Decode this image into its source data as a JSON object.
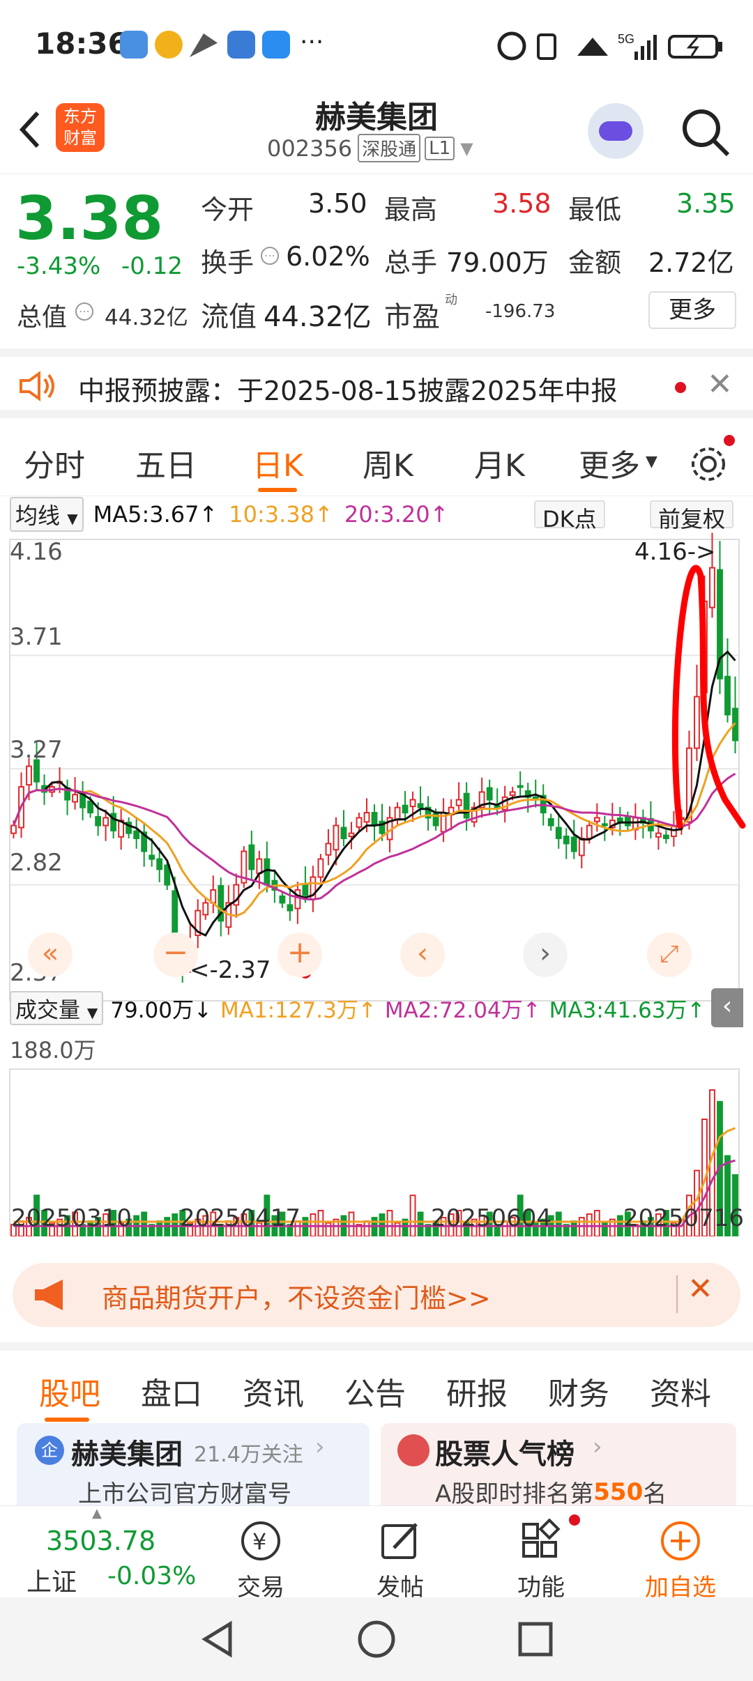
{
  "status_bar": {
    "time": "18:36",
    "dots": "···"
  },
  "header": {
    "logo_line1": "东方",
    "logo_line2": "财富",
    "stock_name": "赫美集团",
    "stock_code": "002356",
    "market_tag": "深股通",
    "level_tag": "L1"
  },
  "quote": {
    "price": "3.38",
    "change_pct": "-3.43%",
    "change": "-0.12",
    "open_label": "今开",
    "open": "3.50",
    "high_label": "最高",
    "high": "3.58",
    "low_label": "最低",
    "low": "3.35",
    "turnover_label": "换手",
    "turnover": "6.02%",
    "volume_label": "总手",
    "volume": "79.00万",
    "amount_label": "金额",
    "amount": "2.72亿",
    "mktcap_label": "总值",
    "mktcap": "44.32亿",
    "float_label": "流值",
    "float_cap": "44.32亿",
    "pe_label": "市盈",
    "pe_sup": "动",
    "pe": "-196.73",
    "more_label": "更多"
  },
  "notice": {
    "text": "中报预披露：于2025-08-15披露2025年中报"
  },
  "period_tabs": [
    "分时",
    "五日",
    "日K",
    "周K",
    "月K",
    "更多"
  ],
  "active_tab": "日K",
  "chart_header": {
    "indicator": "均线",
    "ma5": "MA5:3.67↑",
    "ma10": "10:3.38↑",
    "ma20": "20:3.20↑",
    "dk": "DK点",
    "fq": "前复权"
  },
  "volume_header": {
    "label": "成交量",
    "vol": "79.00万↓",
    "ma1": "MA1:127.3万↑",
    "ma2": "MA2:72.04万↑",
    "ma3": "MA3:41.63万↑",
    "max_label": "188.0万"
  },
  "price_axis": [
    "4.16",
    "3.71",
    "3.27",
    "2.82",
    "2.37"
  ],
  "annotations": {
    "high": "4.16->",
    "low": "<-2.37"
  },
  "date_axis": [
    "20250310",
    "20250417",
    "20250604",
    "20250716"
  ],
  "chart_data": {
    "type": "candlestick",
    "ylim": [
      2.37,
      4.16
    ],
    "y_ticks": [
      4.16,
      3.71,
      3.27,
      2.82,
      2.37
    ],
    "x_ticks": [
      "20250310",
      "20250417",
      "20250604",
      "20250716"
    ],
    "closes": [
      3.05,
      3.2,
      3.28,
      3.22,
      3.18,
      3.2,
      3.22,
      3.15,
      3.17,
      3.12,
      3.1,
      3.05,
      3.08,
      3.03,
      3.07,
      3.02,
      3.0,
      2.95,
      2.92,
      2.88,
      2.82,
      2.55,
      2.5,
      2.6,
      2.72,
      2.75,
      2.8,
      2.68,
      2.75,
      2.82,
      2.95,
      2.88,
      2.92,
      2.82,
      2.8,
      2.75,
      2.72,
      2.8,
      2.78,
      2.85,
      2.92,
      2.98,
      3.05,
      3.0,
      3.02,
      3.08,
      3.1,
      3.05,
      3.02,
      3.08,
      3.12,
      3.1,
      3.15,
      3.12,
      3.08,
      3.05,
      3.1,
      3.12,
      3.15,
      3.08,
      3.12,
      3.18,
      3.15,
      3.12,
      3.16,
      3.18,
      3.2,
      3.16,
      3.15,
      3.1,
      3.05,
      3.0,
      2.98,
      2.95,
      3.0,
      3.05,
      3.08,
      3.05,
      3.07,
      3.06,
      3.05,
      3.08,
      3.06,
      3.03,
      3.02,
      3.0,
      3.05,
      3.08,
      3.35,
      3.55,
      3.92,
      4.05,
      3.62,
      3.48,
      3.38
    ],
    "volume_ma": {
      "MA1": "127.3万",
      "MA2": "72.04万",
      "MA3": "41.63万"
    },
    "volume_max_label": "188.0万"
  },
  "ad_banner": {
    "text": "商品期货开户，不设资金门槛>>"
  },
  "section_tabs": [
    "股吧",
    "盘口",
    "资讯",
    "公告",
    "研报",
    "财务",
    "资料"
  ],
  "cards": {
    "left_title": "赫美集团",
    "left_badge": "企",
    "left_follow": "21.4万关注",
    "left_sub": "上市公司官方财富号",
    "right_title": "股票人气榜",
    "right_sub_pre": "A股即时排名第",
    "right_rank": "550",
    "right_sub_post": "名"
  },
  "bottom_nav": {
    "index_value": "3503.78",
    "index_name": "上证",
    "index_change": "-0.03%",
    "trade": "交易",
    "post": "发帖",
    "function": "功能",
    "add": "加自选"
  },
  "colors": {
    "up": "#e0262a",
    "down": "#0f9a33",
    "ma5": "#111111",
    "ma10": "#f0a020",
    "ma20": "#c0309a",
    "accent": "#ff6a00"
  }
}
